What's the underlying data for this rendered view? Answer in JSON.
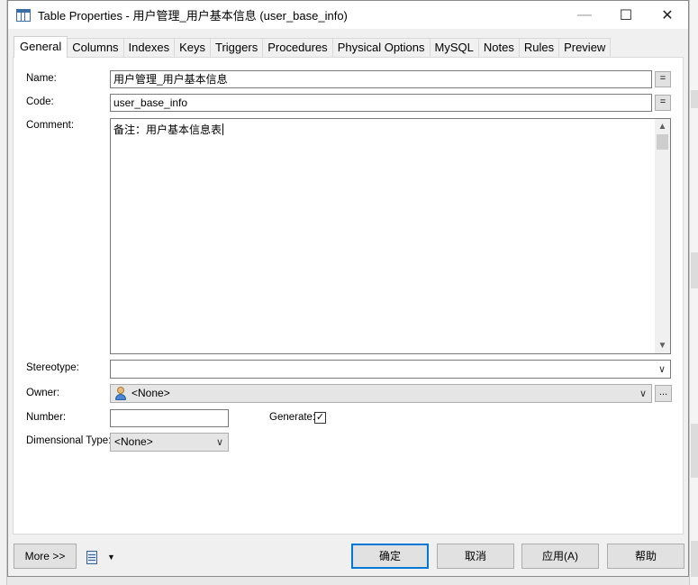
{
  "window": {
    "title": "Table Properties - 用户管理_用户基本信息 (user_base_info)",
    "controls": {
      "minimize": "—",
      "maximize": "☐",
      "close": "✕"
    }
  },
  "tabs": [
    {
      "label": "General",
      "active": true
    },
    {
      "label": "Columns"
    },
    {
      "label": "Indexes"
    },
    {
      "label": "Keys"
    },
    {
      "label": "Triggers"
    },
    {
      "label": "Procedures"
    },
    {
      "label": "Physical Options"
    },
    {
      "label": "MySQL"
    },
    {
      "label": "Notes"
    },
    {
      "label": "Rules"
    },
    {
      "label": "Preview"
    }
  ],
  "general": {
    "name_label": "Name:",
    "name_value": "用户管理_用户基本信息",
    "code_label": "Code:",
    "code_value": "user_base_info",
    "comment_label": "Comment:",
    "comment_value": "备注：用户基本信息表",
    "stereotype_label": "Stereotype:",
    "stereotype_value": "",
    "owner_label": "Owner:",
    "owner_value": "<None>",
    "number_label": "Number:",
    "number_value": "",
    "generate_label": "Generate:",
    "generate_checked": true,
    "dimensional_label": "Dimensional Type:",
    "dimensional_value": "<None>",
    "eq_button": "=",
    "browse_button": "..."
  },
  "footer": {
    "more": "More >>",
    "ok": "确定",
    "cancel": "取消",
    "apply": "应用(A)",
    "help": "帮助"
  },
  "icons": {
    "check": "✓",
    "chevron_down": "∨",
    "scroll_up": "▲",
    "scroll_down": "▼",
    "dropdown_arrow": "▼"
  },
  "colors": {
    "accent": "#0078d7",
    "panel_bg": "#ffffff",
    "window_bg": "#f0f0f0"
  }
}
